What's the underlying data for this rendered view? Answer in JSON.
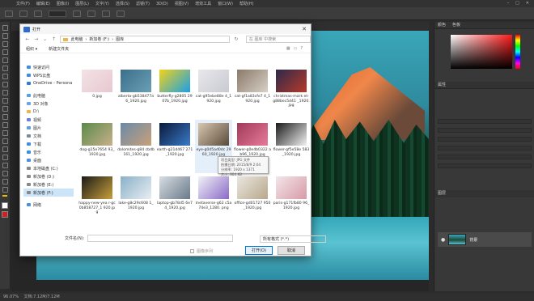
{
  "menubar": {
    "items": [
      "文件(F)",
      "编辑(E)",
      "图像(I)",
      "图层(L)",
      "文字(Y)",
      "选择(S)",
      "滤镜(T)",
      "3D(D)",
      "视图(V)",
      "增效工具",
      "窗口(W)",
      "帮助(H)"
    ]
  },
  "status": {
    "zoom": "96.07%",
    "doc": "文档:7.12M/7.12M"
  },
  "right_panel": {
    "color_tab": "颜色",
    "color_tab2": "色板",
    "props_tab": "属性",
    "layers_tab": "图层",
    "layer_name": "背景",
    "color_fg": "#ff1a1a"
  },
  "dialog": {
    "title": "打开",
    "path": [
      "此电脑",
      "新加卷 (F:)",
      "图库"
    ],
    "search_placeholder": "在 图库 中搜索",
    "organize": "组织 ▾",
    "new_folder": "新建文件夹",
    "nav": [
      {
        "label": "快速访问",
        "icon": "star-icon",
        "color": "#3a8ee6"
      },
      {
        "label": "WPS云盘",
        "icon": "cloud-icon",
        "color": "#3a8ee6"
      },
      {
        "label": "OneDrive - Persona",
        "icon": "cloud-icon",
        "color": "#2f7bd6"
      },
      {
        "label": "此电脑",
        "icon": "pc-icon",
        "color": "#5aa0e0"
      },
      {
        "label": "3D 对象",
        "icon": "cube-icon",
        "color": "#6aa6e6"
      },
      {
        "label": "D:\\",
        "icon": "folder-icon",
        "color": "#e8b84a"
      },
      {
        "label": "视频",
        "icon": "video-icon",
        "color": "#6a7ee0"
      },
      {
        "label": "图片",
        "icon": "picture-icon",
        "color": "#5aa0e0"
      },
      {
        "label": "文档",
        "icon": "document-icon",
        "color": "#7a8aa0"
      },
      {
        "label": "下载",
        "icon": "download-icon",
        "color": "#3a8ee6"
      },
      {
        "label": "音乐",
        "icon": "music-icon",
        "color": "#3a8ee6"
      },
      {
        "label": "桌面",
        "icon": "desktop-icon",
        "color": "#4a90e2"
      },
      {
        "label": "本地磁盘 (C:)",
        "icon": "drive-icon",
        "color": "#888"
      },
      {
        "label": "新加卷 (D:)",
        "icon": "drive-icon",
        "color": "#888"
      },
      {
        "label": "新加卷 (E:)",
        "icon": "drive-icon",
        "color": "#888"
      },
      {
        "label": "新加卷 (F:)",
        "icon": "drive-icon",
        "color": "#888"
      },
      {
        "label": "网络",
        "icon": "network-icon",
        "color": "#4a90e2"
      }
    ],
    "files": [
      {
        "name": "0.jpg",
        "c1": "#f3e3e6",
        "c2": "#e7c8d0"
      },
      {
        "name": "alberta-gb538477a6_1920.jpg",
        "c1": "#3c6e8a",
        "c2": "#6aa0b6"
      },
      {
        "name": "butterfly-g2805 2907b_1920.jpg",
        "c1": "#f2d21a",
        "c2": "#1aa0e6"
      },
      {
        "name": "cat-g95ebe88e 4_1920.jpg",
        "c1": "#e8e8ec",
        "c2": "#c9c9d2"
      },
      {
        "name": "cat-gf1a83cfe7 4_1920.jpg",
        "c1": "#8a7a6a",
        "c2": "#d8d0c6"
      },
      {
        "name": "christmas-mark et-g88bec5d41 _1920.jpg",
        "c1": "#2a2a4a",
        "c2": "#b83a2a"
      },
      {
        "name": "dog-g15e7654 93_1920.jpg",
        "c1": "#5a8a4a",
        "c2": "#c9b08a"
      },
      {
        "name": "dolomites-g84 cbdb161_1920.jpg",
        "c1": "#6a8aa8",
        "c2": "#c8a07a"
      },
      {
        "name": "earth-g21d467 271_1920.jpg",
        "c1": "#0a1a3a",
        "c2": "#3a7ac8"
      },
      {
        "name": "eye-g0d5ad0dc 2960_1920.jpg",
        "c1": "#d8c8b0",
        "c2": "#5a4a3a"
      },
      {
        "name": "flower-g0e4b0322 ab96_1920.jpg",
        "c1": "#a03a5a",
        "c2": "#e87a9a"
      },
      {
        "name": "flower-gf5e58e 583_1920.jpg",
        "c1": "#1a1a1a",
        "c2": "#f2f2f2"
      },
      {
        "name": "happy-new-yea r-gc0b858727_1 920.jpg",
        "c1": "#1a1a1a",
        "c2": "#c8a03a"
      },
      {
        "name": "lake-g8c29c608 1_1920.jpg",
        "c1": "#8ab0c8",
        "c2": "#e8eef2"
      },
      {
        "name": "laptop-gb78d5 6e74_1920.jpg",
        "c1": "#d8dde2",
        "c2": "#6a7a8a"
      },
      {
        "name": "metaverse-g62 c5a74e3_1280. png",
        "c1": "#f2f2f6",
        "c2": "#8a6ac8"
      },
      {
        "name": "office-gd01727 950_1920.jpg",
        "c1": "#eae6e0",
        "c2": "#b8a88a"
      },
      {
        "name": "paris-g171fb80 96_1920.jpg",
        "c1": "#f2e6ea",
        "c2": "#d89aa6"
      }
    ],
    "tooltip": [
      "项目类型: JPG 文件",
      "拍摄日期: 2015/8/9 2:04",
      "分辨率: 1920 x 1371",
      "大小: 904 KB"
    ],
    "filename_label": "文件名(N):",
    "filetype": "所有格式 (*.*)",
    "image_sequence": "图像序列",
    "open": "打开(O)",
    "cancel": "取消"
  }
}
